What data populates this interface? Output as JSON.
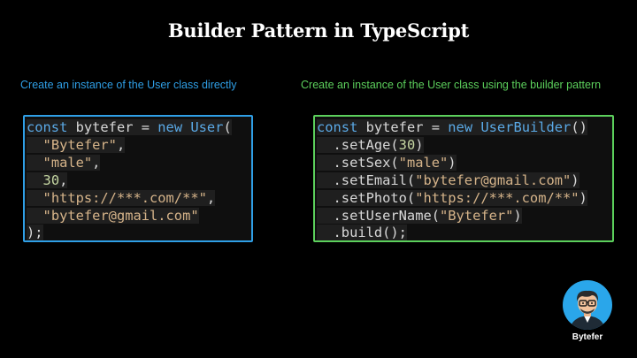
{
  "title": "Builder Pattern in TypeScript",
  "colors": {
    "background": "#000000",
    "left_accent": "#2f9fe6",
    "right_accent": "#5cd05c",
    "code_keyword": "#5aa9e6",
    "code_string": "#d6b48a",
    "code_number": "#c6d7a3",
    "code_default": "#d8d8d8"
  },
  "left_panel": {
    "caption": "Create an instance of the User class directly",
    "code_lines": [
      [
        {
          "t": "const",
          "c": "kw"
        },
        {
          "t": " bytefer = ",
          "c": "plain"
        },
        {
          "t": "new",
          "c": "kw"
        },
        {
          "t": " ",
          "c": "plain"
        },
        {
          "t": "User",
          "c": "kw"
        },
        {
          "t": "(",
          "c": "plain"
        }
      ],
      [
        {
          "t": "  ",
          "c": "plain"
        },
        {
          "t": "\"Bytefer\"",
          "c": "str"
        },
        {
          "t": ",",
          "c": "plain"
        }
      ],
      [
        {
          "t": "  ",
          "c": "plain"
        },
        {
          "t": "\"male\"",
          "c": "str"
        },
        {
          "t": ",",
          "c": "plain"
        }
      ],
      [
        {
          "t": "  ",
          "c": "plain"
        },
        {
          "t": "30",
          "c": "num"
        },
        {
          "t": ",",
          "c": "plain"
        }
      ],
      [
        {
          "t": "  ",
          "c": "plain"
        },
        {
          "t": "\"https://***.com/**\"",
          "c": "str"
        },
        {
          "t": ",",
          "c": "plain"
        }
      ],
      [
        {
          "t": "  ",
          "c": "plain"
        },
        {
          "t": "\"bytefer@gmail.com\"",
          "c": "str"
        }
      ],
      [
        {
          "t": ");",
          "c": "plain"
        }
      ]
    ]
  },
  "right_panel": {
    "caption": "Create an instance of the User class using the builder pattern",
    "code_lines": [
      [
        {
          "t": "const",
          "c": "kw"
        },
        {
          "t": " bytefer = ",
          "c": "plain"
        },
        {
          "t": "new",
          "c": "kw"
        },
        {
          "t": " ",
          "c": "plain"
        },
        {
          "t": "UserBuilder",
          "c": "kw"
        },
        {
          "t": "()",
          "c": "plain"
        }
      ],
      [
        {
          "t": "  .setAge(",
          "c": "plain"
        },
        {
          "t": "30",
          "c": "num"
        },
        {
          "t": ")",
          "c": "plain"
        }
      ],
      [
        {
          "t": "  .setSex(",
          "c": "plain"
        },
        {
          "t": "\"male\"",
          "c": "str"
        },
        {
          "t": ")",
          "c": "plain"
        }
      ],
      [
        {
          "t": "  .setEmail(",
          "c": "plain"
        },
        {
          "t": "\"bytefer@gmail.com\"",
          "c": "str"
        },
        {
          "t": ")",
          "c": "plain"
        }
      ],
      [
        {
          "t": "  .setPhoto(",
          "c": "plain"
        },
        {
          "t": "\"https://***.com/**\"",
          "c": "str"
        },
        {
          "t": ")",
          "c": "plain"
        }
      ],
      [
        {
          "t": "  .setUserName(",
          "c": "plain"
        },
        {
          "t": "\"Bytefer\"",
          "c": "str"
        },
        {
          "t": ")",
          "c": "plain"
        }
      ],
      [
        {
          "t": "  .build();",
          "c": "plain"
        }
      ]
    ]
  },
  "branding": {
    "name": "Bytefer",
    "avatar_icon": "cartoon-avatar-with-glasses-icon"
  }
}
